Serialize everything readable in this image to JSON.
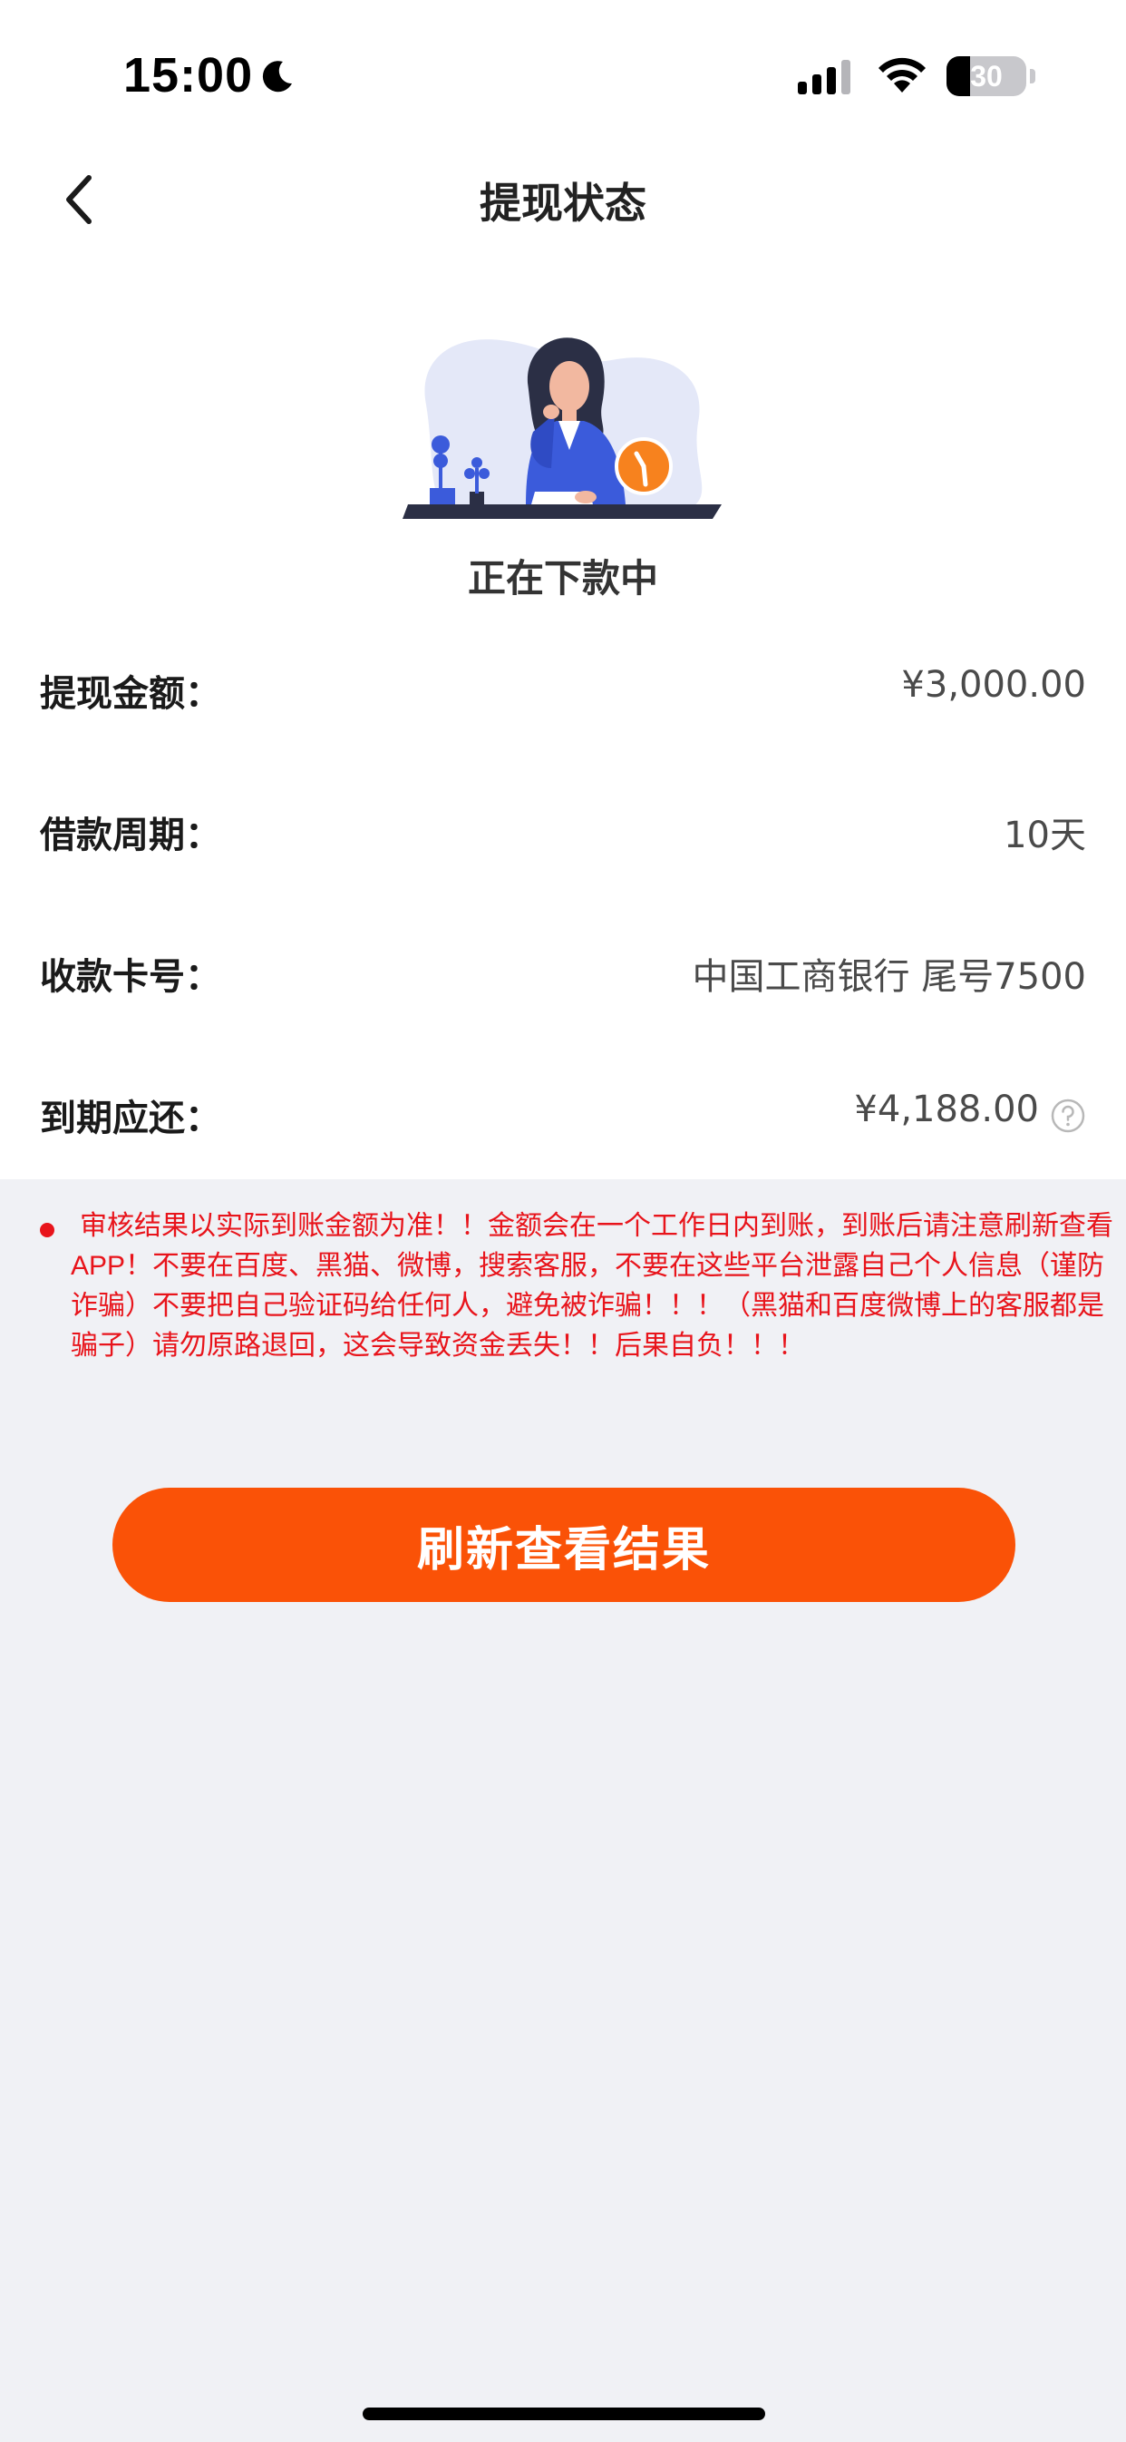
{
  "status_bar": {
    "time": "15:00",
    "battery": "30",
    "battery_level": 0.3
  },
  "nav": {
    "title": "提现状态"
  },
  "status": {
    "text": "正在下款中"
  },
  "rows": [
    {
      "label": "提现金额：",
      "value": "¥3,000.00"
    },
    {
      "label": "借款周期：",
      "value": "10天"
    },
    {
      "label": "收款卡号：",
      "value": "中国工商银行 尾号7500"
    },
    {
      "label": "到期应还：",
      "value": "¥4,188.00"
    }
  ],
  "notice": {
    "text": "审核结果以实际到账金额为准！！金额会在一个工作日内到账，到账后请注意刷新查看APP！不要在百度、黑猫、微博，搜索客服，不要在这些平台泄露自己个人信息（谨防诈骗）不要把自己验证码给任何人，避免被诈骗！！！（黑猫和百度微博上的客服都是骗子）请勿原路退回，这会导致资金丢失！！后果自负！！！"
  },
  "button": {
    "label": "刷新查看结果"
  },
  "colors": {
    "accent": "#fa5207",
    "notice": "#e8141b",
    "background": "#f0f1f5"
  }
}
